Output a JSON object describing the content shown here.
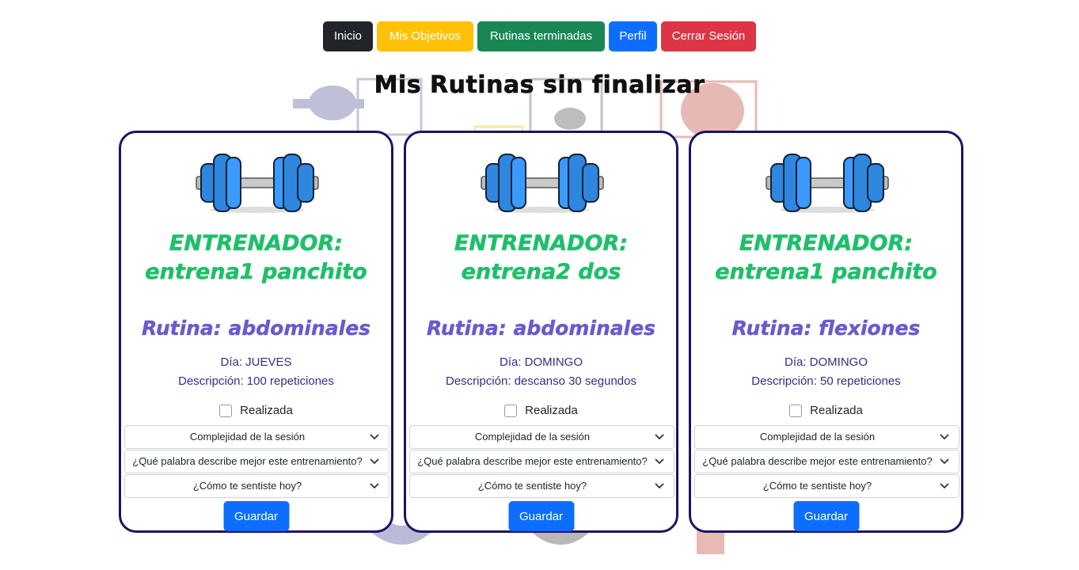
{
  "nav": {
    "home": "Inicio",
    "goals": "Mis Objetivos",
    "finished": "Rutinas terminadas",
    "profile": "Perfil",
    "logout": "Cerrar Sesión"
  },
  "page": {
    "title": "Mis Rutinas sin finalizar"
  },
  "cards": [
    {
      "coach_label": "ENTRENADOR:",
      "coach_name": "entrena1 panchito",
      "routine": "Rutina: abdominales",
      "day": "Día: JUEVES",
      "description": "Descripción: 100 repeticiones",
      "done_label": "Realizada",
      "select_complexity": "Complejidad de la sesión",
      "select_word": "¿Qué palabra describe mejor este entrenamiento?",
      "select_feeling": "¿Cómo te sentiste hoy?",
      "save_label": "Guardar"
    },
    {
      "coach_label": "ENTRENADOR:",
      "coach_name": "entrena2 dos",
      "routine": "Rutina: abdominales",
      "day": "Día: DOMINGO",
      "description": "Descripción: descanso 30 segundos",
      "done_label": "Realizada",
      "select_complexity": "Complejidad de la sesión",
      "select_word": "¿Qué palabra describe mejor este entrenamiento?",
      "select_feeling": "¿Cómo te sentiste hoy?",
      "save_label": "Guardar"
    },
    {
      "coach_label": "ENTRENADOR:",
      "coach_name": "entrena1 panchito",
      "routine": "Rutina: flexiones",
      "day": "Día: DOMINGO",
      "description": "Descripción: 50 repeticiones",
      "done_label": "Realizada",
      "select_complexity": "Complejidad de la sesión",
      "select_word": "¿Qué palabra describe mejor este entrenamiento?",
      "select_feeling": "¿Cómo te sentiste hoy?",
      "save_label": "Guardar"
    }
  ],
  "colors": {
    "coach": "#1fbf6a",
    "routine": "#6a5acd",
    "card_border": "#1b1464",
    "primary": "#0d6efd"
  },
  "icons": {
    "card_image": "dumbbell-icon",
    "select_arrow": "chevron-down-icon"
  }
}
